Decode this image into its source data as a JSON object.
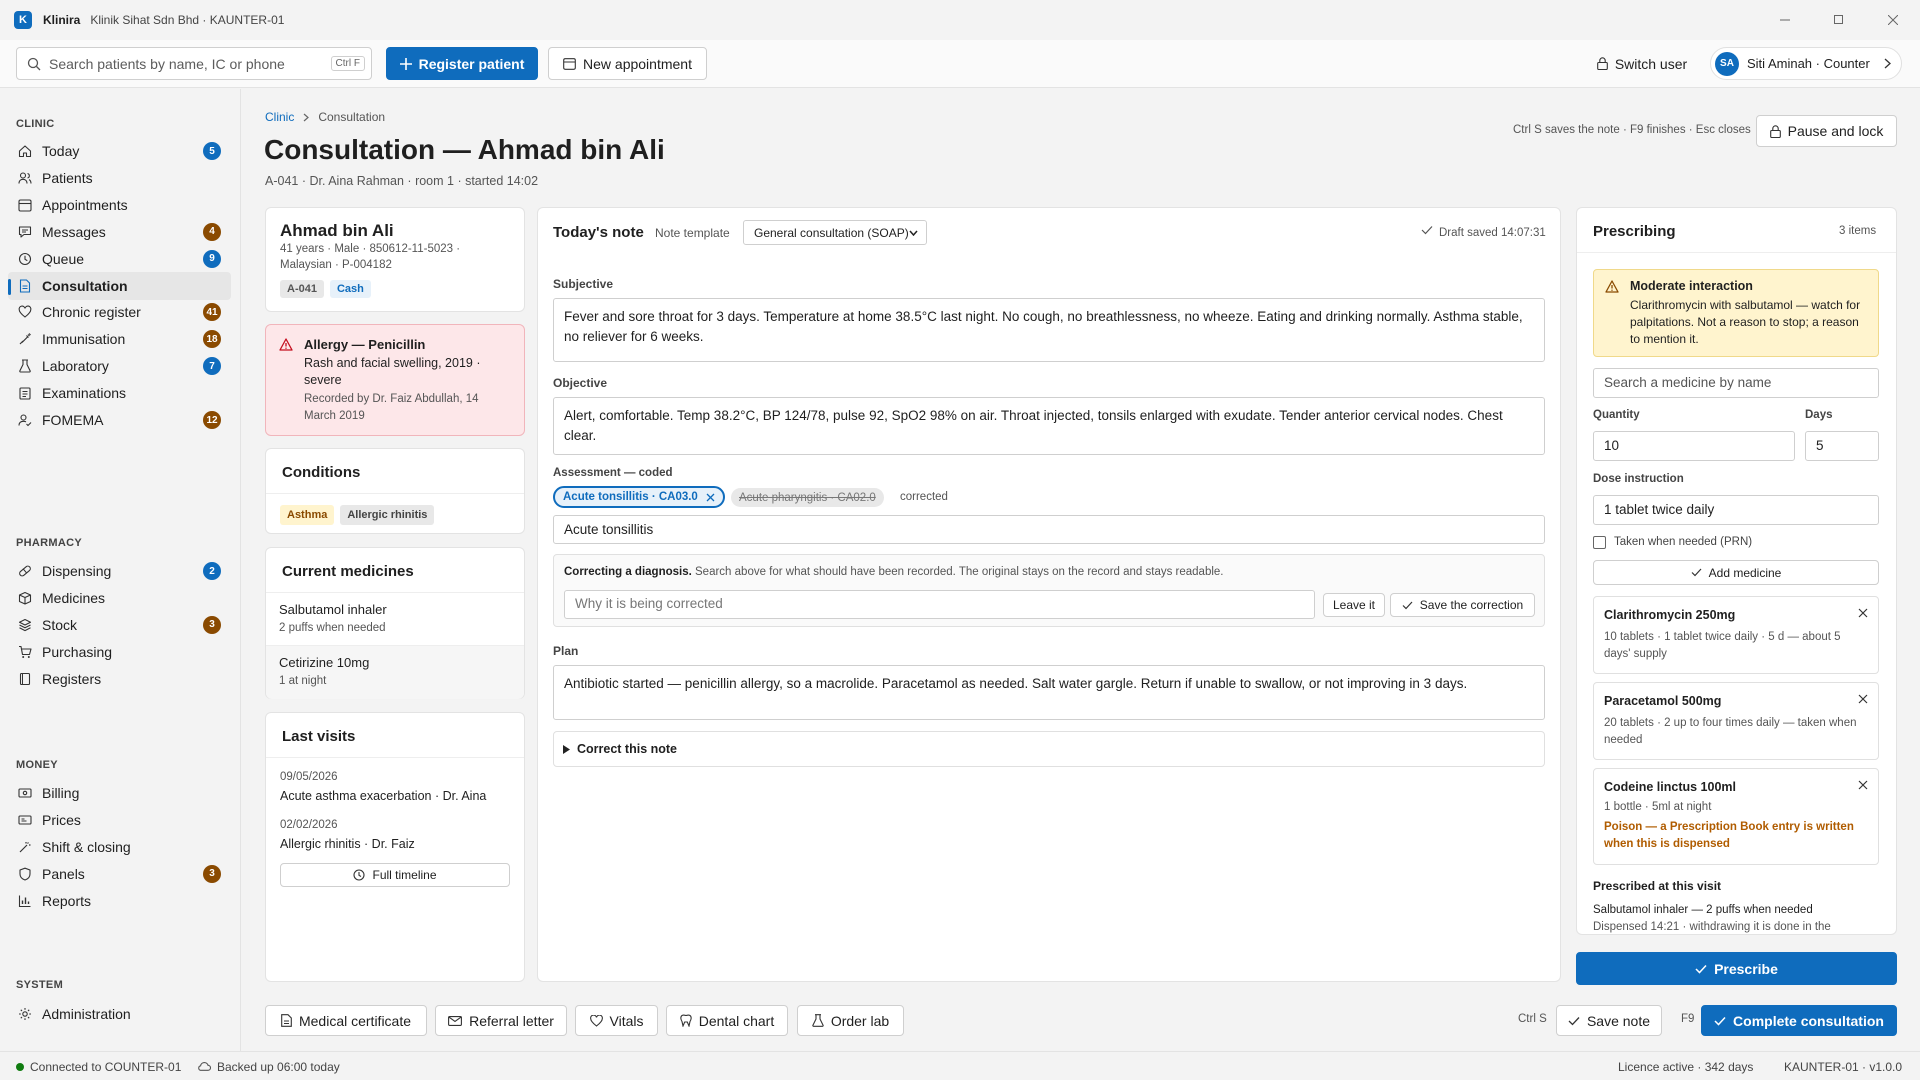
{
  "titlebar": {
    "logo": "K",
    "app_name": "Klinira",
    "subtitle": "Klinik Sihat Sdn Bhd · KAUNTER-01"
  },
  "toolbar": {
    "search_placeholder": "Search patients by name, IC or phone",
    "search_shortcut": "Ctrl F",
    "register_label": "Register patient",
    "appointment_label": "New appointment",
    "switch_user_label": "Switch user",
    "user_initials": "SA",
    "user_label": "Siti Aminah · Counter"
  },
  "sidebar": {
    "sections": [
      "CLINIC",
      "PHARMACY",
      "MONEY",
      "SYSTEM"
    ],
    "clinic": [
      {
        "label": "Today",
        "badge": "5",
        "icon": "home-icon"
      },
      {
        "label": "Patients",
        "badge": "",
        "icon": "people-icon"
      },
      {
        "label": "Appointments",
        "badge": "",
        "icon": "calendar-icon"
      },
      {
        "label": "Messages",
        "badge": "4",
        "icon": "chat-icon"
      },
      {
        "label": "Queue",
        "badge": "9",
        "icon": "clock-icon"
      },
      {
        "label": "Consultation",
        "badge": "",
        "icon": "document-icon"
      },
      {
        "label": "Chronic register",
        "badge": "41",
        "icon": "heart-icon"
      },
      {
        "label": "Immunisation",
        "badge": "18",
        "icon": "syringe-icon"
      },
      {
        "label": "Laboratory",
        "badge": "7",
        "icon": "flask-icon"
      },
      {
        "label": "Examinations",
        "badge": "",
        "icon": "clipboard-icon"
      },
      {
        "label": "FOMEMA",
        "badge": "12",
        "icon": "person-check-icon"
      }
    ],
    "pharmacy": [
      {
        "label": "Dispensing",
        "badge": "2",
        "icon": "pill-icon"
      },
      {
        "label": "Medicines",
        "badge": "",
        "icon": "box-icon"
      },
      {
        "label": "Stock",
        "badge": "3",
        "icon": "stack-icon"
      },
      {
        "label": "Purchasing",
        "badge": "",
        "icon": "cart-icon"
      },
      {
        "label": "Registers",
        "badge": "",
        "icon": "book-icon"
      }
    ],
    "money": [
      {
        "label": "Billing",
        "badge": "",
        "icon": "cash-icon"
      },
      {
        "label": "Prices",
        "badge": "",
        "icon": "tag-icon"
      },
      {
        "label": "Shift & closing",
        "badge": "",
        "icon": "wand-icon"
      },
      {
        "label": "Panels",
        "badge": "3",
        "icon": "shield-icon"
      },
      {
        "label": "Reports",
        "badge": "",
        "icon": "bar-chart-icon"
      }
    ],
    "system": [
      {
        "label": "Administration",
        "badge": "",
        "icon": "gear-icon"
      }
    ]
  },
  "header": {
    "breadcrumb_root": "Clinic",
    "breadcrumb_current": "Consultation",
    "title": "Consultation — Ahmad bin Ali",
    "subtitle": "A-041 · Dr. Aina Rahman · room 1 · started 14:02",
    "shortcuts_hint": "Ctrl S saves the note · F9 finishes · Esc closes",
    "pause_label": "Pause and lock"
  },
  "patient": {
    "name": "Ahmad bin Ali",
    "details": "41 years · Male · 850612-11-5023 · Malaysian · P-004182",
    "queue_chip": "A-041",
    "payment_chip": "Cash"
  },
  "allergy": {
    "title": "Allergy — Penicillin",
    "reaction": "Rash and facial swelling, 2019 · severe",
    "recorded": "Recorded by Dr. Faiz Abdullah, 14 March 2019"
  },
  "conditions": {
    "title": "Conditions",
    "items": [
      "Asthma",
      "Allergic rhinitis"
    ]
  },
  "medicines": {
    "title": "Current medicines",
    "items": [
      {
        "name": "Salbutamol inhaler",
        "dose": "2 puffs when needed"
      },
      {
        "name": "Cetirizine 10mg",
        "dose": "1 at night"
      }
    ]
  },
  "visits": {
    "title": "Last visits",
    "items": [
      {
        "date": "09/05/2026",
        "summary": "Acute asthma exacerbation · Dr. Aina"
      },
      {
        "date": "02/02/2026",
        "summary": "Allergic rhinitis · Dr. Faiz"
      }
    ],
    "timeline_label": "Full timeline"
  },
  "note": {
    "title": "Today's note",
    "template_label": "Note template",
    "template_value": "General consultation (SOAP)",
    "saved_status": "Draft saved 14:07:31",
    "subjective_label": "Subjective",
    "subjective": "Fever and sore throat for 3 days. Temperature at home 38.5°C last night. No cough, no breathlessness, no wheeze. Eating and drinking normally. Asthma stable, no reliever for 6 weeks.",
    "objective_label": "Objective",
    "objective": "Alert, comfortable. Temp 38.2°C, BP 124/78, pulse 92, SpO2 98% on air. Throat injected, tonsils enlarged with exudate. Tender anterior cervical nodes. Chest clear.",
    "assessment_label": "Assessment — coded",
    "diagnosis_active": "Acute tonsillitis · CA03.0",
    "diagnosis_struck": "Acute pharyngitis · CA02.0",
    "corrected_label": "corrected",
    "diagnosis_search": "Acute tonsillitis",
    "correcting_title": "Correcting a diagnosis.",
    "correcting_text": "Search above for what should have been recorded. The original stays on the record and stays readable.",
    "reason_placeholder": "Why it is being corrected",
    "leave_label": "Leave it",
    "save_correction_label": "Save the correction",
    "plan_label": "Plan",
    "plan": "Antibiotic started — penicillin allergy, so a macrolide. Paracetamol as needed. Salt water gargle. Return if unable to swallow, or not improving in 3 days.",
    "correct_note_label": "Correct this note"
  },
  "prescribing": {
    "title": "Prescribing",
    "count": "3 items",
    "warning_title": "Moderate interaction",
    "warning_text": "Clarithromycin with salbutamol — watch for palpitations. Not a reason to stop; a reason to mention it.",
    "search_placeholder": "Search a medicine by name",
    "quantity_label": "Quantity",
    "quantity": "10",
    "days_label": "Days",
    "days": "5",
    "dose_label": "Dose instruction",
    "dose": "1 tablet twice daily",
    "prn_label": "Taken when needed (PRN)",
    "add_label": "Add medicine",
    "items": [
      {
        "name": "Clarithromycin 250mg",
        "detail": "10 tablets · 1 tablet twice daily · 5 d — about 5 days' supply",
        "warning": ""
      },
      {
        "name": "Paracetamol 500mg",
        "detail": "20 tablets · 2 up to four times daily — taken when needed",
        "warning": ""
      },
      {
        "name": "Codeine linctus 100ml",
        "detail": "1 bottle · 5ml at night",
        "warning": "Poison — a Prescription Book entry is written when this is dispensed"
      }
    ],
    "prescribed_title": "Prescribed at this visit",
    "prescribed_line1": "Salbutamol inhaler — 2 puffs when needed",
    "prescribed_line2": "Dispensed 14:21 · withdrawing it is done in the",
    "prescribe_label": "Prescribe"
  },
  "footer": {
    "medical_certificate": "Medical certificate",
    "referral_letter": "Referral letter",
    "vitals": "Vitals",
    "dental_chart": "Dental chart",
    "order_lab": "Order lab",
    "save_shortcut": "Ctrl S",
    "save_note": "Save note",
    "complete_shortcut": "F9",
    "complete": "Complete consultation"
  },
  "statusbar": {
    "connection": "Connected to COUNTER-01",
    "backup": "Backed up 06:00 today",
    "licence": "Licence active · 342 days",
    "version": "KAUNTER-01 · v1.0.0"
  },
  "colors": {
    "accent": "#0f6cbd",
    "allergy_bg": "#fde7e9",
    "warning_bg": "#fff4ce",
    "badge_brown": "#8a4a00",
    "online": "#107c10"
  }
}
